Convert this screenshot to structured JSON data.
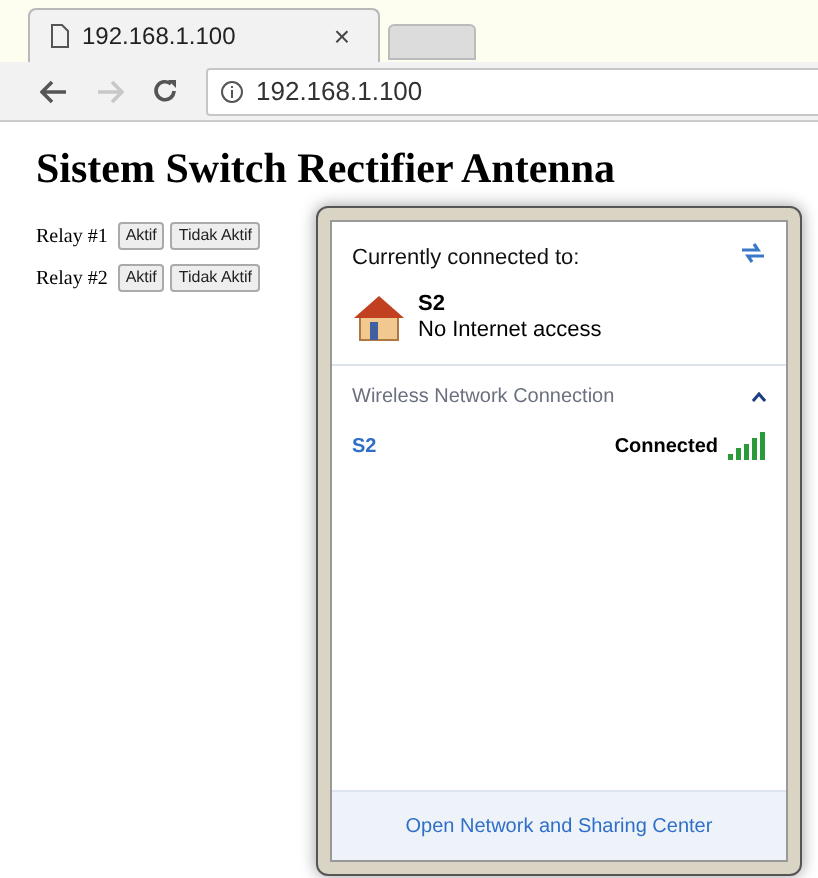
{
  "browser": {
    "tab_title": "192.168.1.100",
    "tab_close": "×",
    "url": "192.168.1.100"
  },
  "page": {
    "heading": "Sistem Switch Rectifier Antenna",
    "relays": [
      {
        "label": "Relay #1",
        "buttons": [
          "Aktif",
          "Tidak Aktif"
        ]
      },
      {
        "label": "Relay #2",
        "buttons": [
          "Aktif",
          "Tidak Aktif"
        ]
      }
    ]
  },
  "network_popup": {
    "header": "Currently connected to:",
    "current_network": {
      "name": "S2",
      "status": "No Internet access"
    },
    "section": {
      "title": "Wireless Network Connection",
      "expanded": true
    },
    "networks": [
      {
        "name": "S2",
        "status": "Connected"
      }
    ],
    "footer_link": "Open Network and Sharing Center"
  }
}
